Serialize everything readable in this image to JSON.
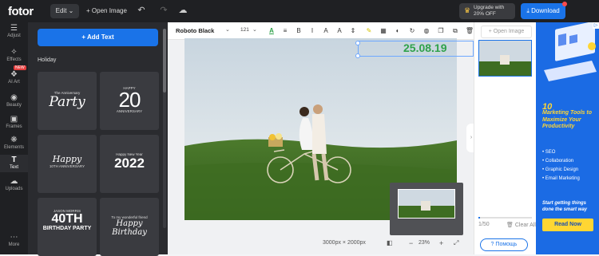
{
  "topbar": {
    "logo": "fotor",
    "edit_label": "Edit",
    "open_image_label": "Open Image",
    "upgrade_line1": "Upgrade with",
    "upgrade_line2": "20% OFF",
    "download_label": "Download"
  },
  "rail": {
    "items": [
      {
        "label": "Adjust",
        "icon": "sliders-icon"
      },
      {
        "label": "Effects",
        "icon": "effects-icon"
      },
      {
        "label": "AI Art",
        "icon": "ai-art-icon"
      },
      {
        "label": "Beauty",
        "icon": "beauty-icon"
      },
      {
        "label": "Frames",
        "icon": "frames-icon"
      },
      {
        "label": "Elements",
        "icon": "elements-icon"
      },
      {
        "label": "Text",
        "icon": "text-icon"
      },
      {
        "label": "Uploads",
        "icon": "uploads-icon"
      },
      {
        "label": "More",
        "icon": "more-icon"
      }
    ],
    "new_badge": "NEW"
  },
  "panel": {
    "add_text_label": "Add Text",
    "section_title": "Holiday",
    "tiles": [
      {
        "line1": "The Anniversary",
        "line2": "Party",
        "line3": ""
      },
      {
        "line1": "HAPPY",
        "line2": "20",
        "line3": "ANNIVERSARY"
      },
      {
        "line1": "Happy",
        "line2": "10TH ANNIVERSARY",
        "line3": ""
      },
      {
        "line1": "Happy New Year",
        "line2": "2022",
        "line3": ""
      },
      {
        "line1": "JASON MORRIS",
        "line2": "40TH",
        "line3": "BIRTHDAY PARTY"
      },
      {
        "line1": "To my wonderful friend",
        "line2": "Happy Birthday",
        "line3": ""
      }
    ]
  },
  "toolbar": {
    "font_name": "Roboto Black",
    "font_size": "121"
  },
  "canvas": {
    "date_text": "25.08.19",
    "dimensions": "3000px × 2000px",
    "zoom": "23%"
  },
  "layers": {
    "open_image_label": "Open Image",
    "count": "1/50",
    "clear_all_label": "Clear All",
    "help_label": "Помощь"
  },
  "ad": {
    "number": "10",
    "title": "Marketing Tools to Maximize Your Productivity",
    "items": [
      "SEO",
      "Collaboration",
      "Graphic Design",
      "Email Marketing"
    ],
    "sub": "Start getting things done the smart way",
    "button_label": "Read Now"
  },
  "colors": {
    "accent": "#1a73e8",
    "date_green": "#2fa24a",
    "ad_yellow": "#ffd633"
  }
}
